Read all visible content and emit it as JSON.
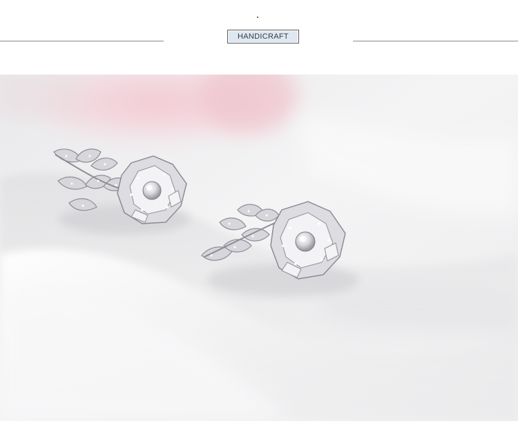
{
  "header": {
    "badge_label": "HANDICRAFT"
  },
  "photo": {
    "subject": "earrings-photo",
    "colors": {
      "background_white": "#f3f3f3",
      "pink_blur": "#f2c9d2",
      "silver": "#cfcfd4"
    }
  }
}
